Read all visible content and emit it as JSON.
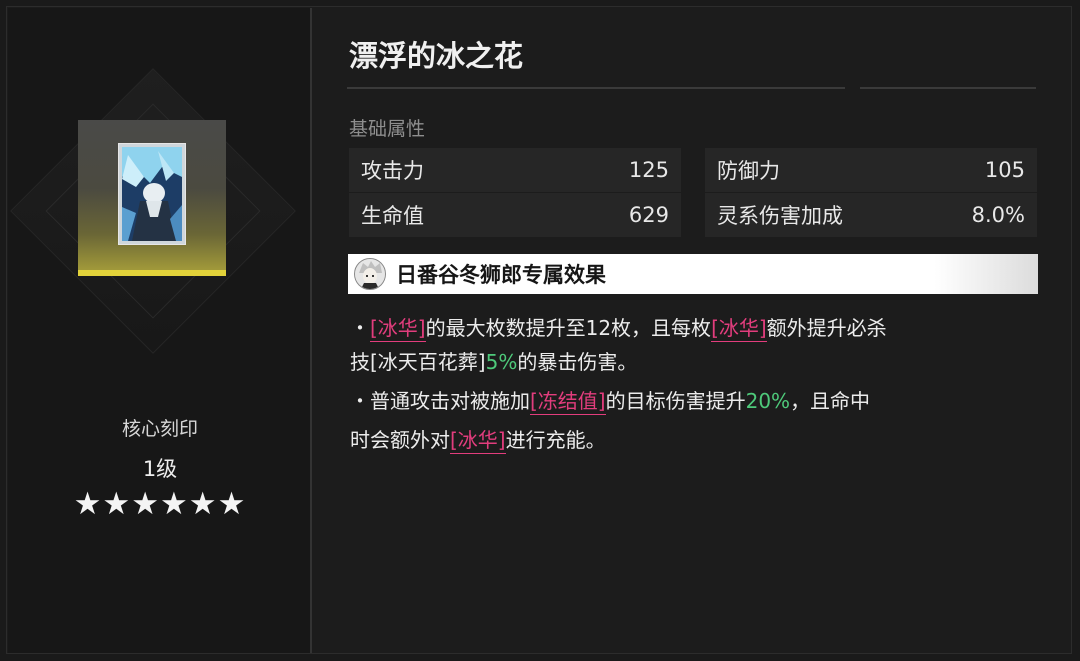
{
  "item": {
    "title": "漂浮的冰之花"
  },
  "imprint": {
    "label": "核心刻印",
    "level": "1级",
    "stars": "★★★★★★",
    "rating": 6
  },
  "basic": {
    "section_label": "基础属性",
    "stats": [
      {
        "name": "攻击力",
        "value": "125"
      },
      {
        "name": "防御力",
        "value": "105"
      },
      {
        "name": "生命值",
        "value": "629"
      },
      {
        "name": "灵系伤害加成",
        "value": "8.0%"
      }
    ]
  },
  "exclusive": {
    "title": "日番谷冬狮郎专属效果",
    "line1": {
      "bullet": "・",
      "kw1": "[冰华]",
      "t1": "的最大枚数提升至12枚，且每枚",
      "kw2": "[冰华]",
      "t2": "额外提升必杀"
    },
    "line2": {
      "t1": "技[冰天百花葬]",
      "pct": "5%",
      "t2": "的暴击伤害。"
    },
    "line3": {
      "bullet": "・",
      "t1": "普通攻击对被施加",
      "kw": "[冻结值]",
      "t2": "的目标伤害提升",
      "pct": "20%",
      "t3": "，且命中"
    },
    "line4": {
      "t1": "时会额外对",
      "kw": "[冰华]",
      "t2": "进行充能。"
    }
  },
  "colors": {
    "keyword": "#e23d7d",
    "percent": "#4ec97a",
    "card_accent": "#e2d23a"
  }
}
